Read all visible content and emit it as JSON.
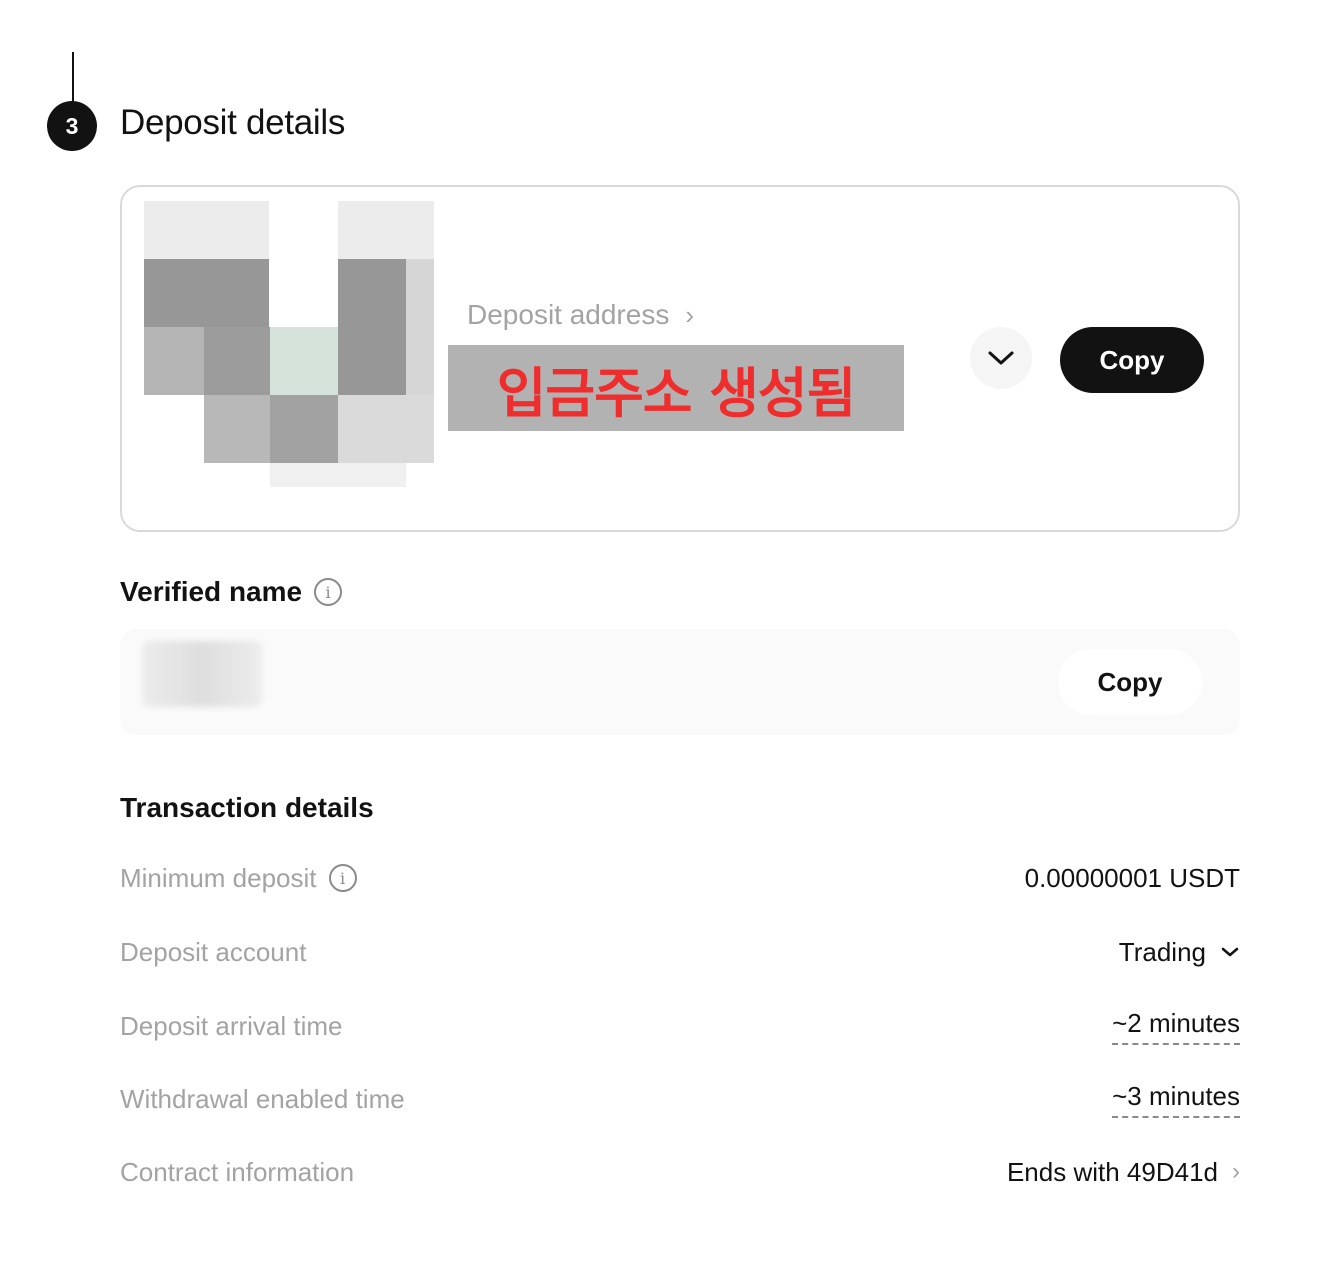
{
  "step": {
    "number": "3",
    "title": "Deposit details"
  },
  "deposit_address": {
    "label": "Deposit address",
    "value": "입금주소 생성됨",
    "copy_label": "Copy",
    "label_icon": "chevron-right-icon",
    "toggle_icon": "chevron-down-icon"
  },
  "verified_name": {
    "label": "Verified name",
    "info_icon": "info-icon",
    "copy_label": "Copy"
  },
  "transaction": {
    "title": "Transaction details",
    "rows": [
      {
        "label": "Minimum deposit",
        "value": "0.00000001 USDT"
      },
      {
        "label": "Deposit account",
        "value": "Trading"
      },
      {
        "label": "Deposit arrival time",
        "value": "~2 minutes"
      },
      {
        "label": "Withdrawal enabled time",
        "value": "~3 minutes"
      },
      {
        "label": "Contract information",
        "value": "Ends with 49D41d"
      }
    ]
  },
  "colors": {
    "text_primary": "#121212",
    "text_secondary": "#a3a3a3",
    "address_overlay_text": "#ef2d2d",
    "button_dark": "#121212",
    "card_border": "#d9d9d9"
  }
}
